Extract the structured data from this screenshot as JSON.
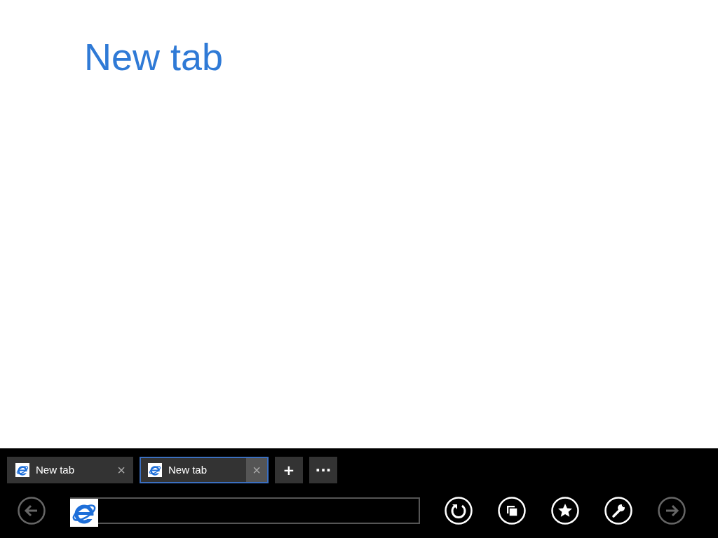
{
  "page": {
    "heading": "New tab"
  },
  "tabs": [
    {
      "label": "New tab",
      "close": "×",
      "selected": false
    },
    {
      "label": "New tab",
      "close": "×",
      "selected": true
    }
  ],
  "tab_actions": [
    "+",
    "···"
  ],
  "nav_buttons": [
    {
      "kind": "back",
      "disabled": true
    },
    {
      "kind": "refresh",
      "disabled": false
    },
    {
      "kind": "tabs",
      "disabled": false
    },
    {
      "kind": "favorites",
      "disabled": false
    },
    {
      "kind": "tools",
      "disabled": false
    },
    {
      "kind": "forward",
      "disabled": true
    }
  ]
}
